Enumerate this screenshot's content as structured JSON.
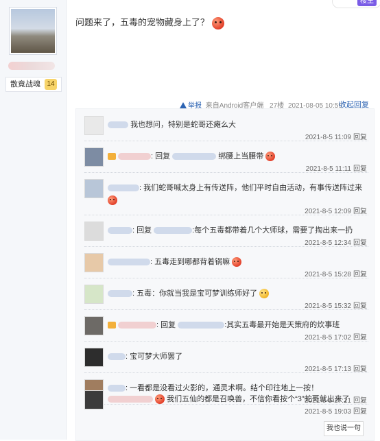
{
  "user": {
    "badge_label": "散竟战魂",
    "badge_level": "14"
  },
  "corner": {
    "label": "楼主"
  },
  "post": {
    "text": "问题来了，五毒的宠物藏身上了？"
  },
  "meta": {
    "report": "举报",
    "source": "来自Android客户端",
    "floor": "27楼",
    "datetime": "2021-08-05 10:59",
    "collapse": "收起回复"
  },
  "replies": [
    {
      "pre": "",
      "text": "我也想问，特别是蛇哥还瘫么大",
      "time": "2021-8-5 11:09",
      "action": "回复"
    },
    {
      "pre": "回复",
      "text": "绑腰上当腰带",
      "time": "2021-8-5 11:11",
      "action": "回复"
    },
    {
      "pre": "",
      "text": "我们蛇哥喊太身上有传送阵，他们平时自由活动，有事传送阵过来",
      "time": "2021-8-5 12:09",
      "action": "回复"
    },
    {
      "pre": "回复",
      "text": ":每个五毒都带着几个大师球，需要了掏出来一扔",
      "time": "2021-8-5 12:34",
      "action": "回复"
    },
    {
      "pre": "",
      "text": "五毒走到哪都背着锅嘛",
      "time": "2021-8-5 15:28",
      "action": "回复"
    },
    {
      "pre": "",
      "text": "五毒：你就当我是宝可梦训练师好了",
      "time": "2021-8-5 15:32",
      "action": "回复"
    },
    {
      "pre": "回复",
      "text": ":其实五毒最开始是天策府的炊事班",
      "time": "2021-8-5 17:02",
      "action": "回复"
    },
    {
      "pre": "",
      "text": "宝可梦大师罢了",
      "time": "2021-8-5 17:13",
      "action": "回复"
    },
    {
      "pre": "",
      "text": "一看都是没看过火影的，通灵术啊。结个印往地上一按！",
      "time": "2021-8-5 17:21",
      "action": "回复"
    },
    {
      "pre": "",
      "text": "我们五仙的都是召唤兽，不信你看按个“3”蛇哥就出来了",
      "time": "2021-8-5 19:03",
      "action": "回复"
    }
  ],
  "reply_button": "我也说一句"
}
